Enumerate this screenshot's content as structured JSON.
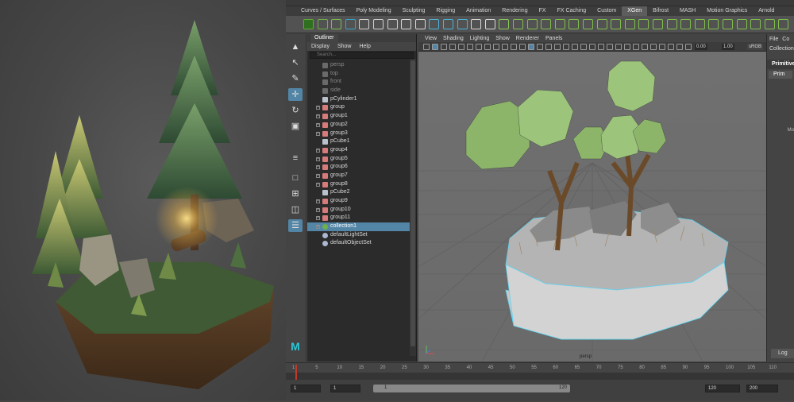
{
  "shelf": {
    "tabs": [
      "Curves / Surfaces",
      "Poly Modeling",
      "Sculpting",
      "Rigging",
      "Animation",
      "Rendering",
      "FX",
      "FX Caching",
      "Custom",
      "XGen",
      "Bifrost",
      "MASH",
      "Motion Graphics",
      "Arnold"
    ],
    "active_tab": "XGen"
  },
  "outliner": {
    "title": "Outliner",
    "menu": [
      "Display",
      "Show",
      "Help"
    ],
    "search_placeholder": "Search...",
    "items": [
      {
        "label": "persp",
        "kind": "camera",
        "expandable": false,
        "selected": false
      },
      {
        "label": "top",
        "kind": "camera",
        "expandable": false,
        "selected": false
      },
      {
        "label": "front",
        "kind": "camera",
        "expandable": false,
        "selected": false
      },
      {
        "label": "side",
        "kind": "camera",
        "expandable": false,
        "selected": false
      },
      {
        "label": "pCylinder1",
        "kind": "mesh",
        "expandable": false,
        "selected": false
      },
      {
        "label": "group",
        "kind": "group",
        "expandable": true,
        "selected": false
      },
      {
        "label": "group1",
        "kind": "group",
        "expandable": true,
        "selected": false
      },
      {
        "label": "group2",
        "kind": "group",
        "expandable": true,
        "selected": false
      },
      {
        "label": "group3",
        "kind": "group",
        "expandable": true,
        "selected": false
      },
      {
        "label": "pCube1",
        "kind": "mesh",
        "expandable": false,
        "selected": false
      },
      {
        "label": "group4",
        "kind": "group",
        "expandable": true,
        "selected": false
      },
      {
        "label": "group5",
        "kind": "group",
        "expandable": true,
        "selected": false
      },
      {
        "label": "group6",
        "kind": "group",
        "expandable": true,
        "selected": false
      },
      {
        "label": "group7",
        "kind": "group",
        "expandable": true,
        "selected": false
      },
      {
        "label": "group8",
        "kind": "group",
        "expandable": true,
        "selected": false
      },
      {
        "label": "pCube2",
        "kind": "mesh",
        "expandable": false,
        "selected": false
      },
      {
        "label": "group9",
        "kind": "group",
        "expandable": true,
        "selected": false
      },
      {
        "label": "group10",
        "kind": "group",
        "expandable": true,
        "selected": false
      },
      {
        "label": "group11",
        "kind": "group",
        "expandable": true,
        "selected": false
      },
      {
        "label": "collection1",
        "kind": "collection",
        "expandable": true,
        "selected": true
      },
      {
        "label": "defaultLightSet",
        "kind": "set",
        "expandable": false,
        "selected": false
      },
      {
        "label": "defaultObjectSet",
        "kind": "set",
        "expandable": false,
        "selected": false
      }
    ]
  },
  "viewport": {
    "menu": [
      "View",
      "Shading",
      "Lighting",
      "Show",
      "Renderer",
      "Panels"
    ],
    "exposure": "0.00",
    "gamma": "1.00",
    "color_space": "sRGB",
    "camera_label": "persp"
  },
  "attribute_editor": {
    "menu": [
      "File",
      "Co"
    ],
    "tab": "Collection",
    "section1": "Primitive",
    "section2": "Prim",
    "side_label": "Mo",
    "log_button": "Log"
  },
  "timeline": {
    "ticks": [
      "1",
      "5",
      "10",
      "15",
      "20",
      "25",
      "30",
      "35",
      "40",
      "45",
      "50",
      "55",
      "60",
      "65",
      "70",
      "75",
      "80",
      "85",
      "90",
      "95",
      "100",
      "105",
      "110"
    ],
    "current_frame": 1
  },
  "range": {
    "start": "1",
    "playback_start": "1",
    "slider_start": "1",
    "slider_end": "120",
    "playback_end": "120",
    "end": "200"
  },
  "colors": {
    "selection": "#5285a6",
    "foliage": "#8cb56a",
    "trunk": "#6b4a2a",
    "wire": "#5fd3f0"
  }
}
